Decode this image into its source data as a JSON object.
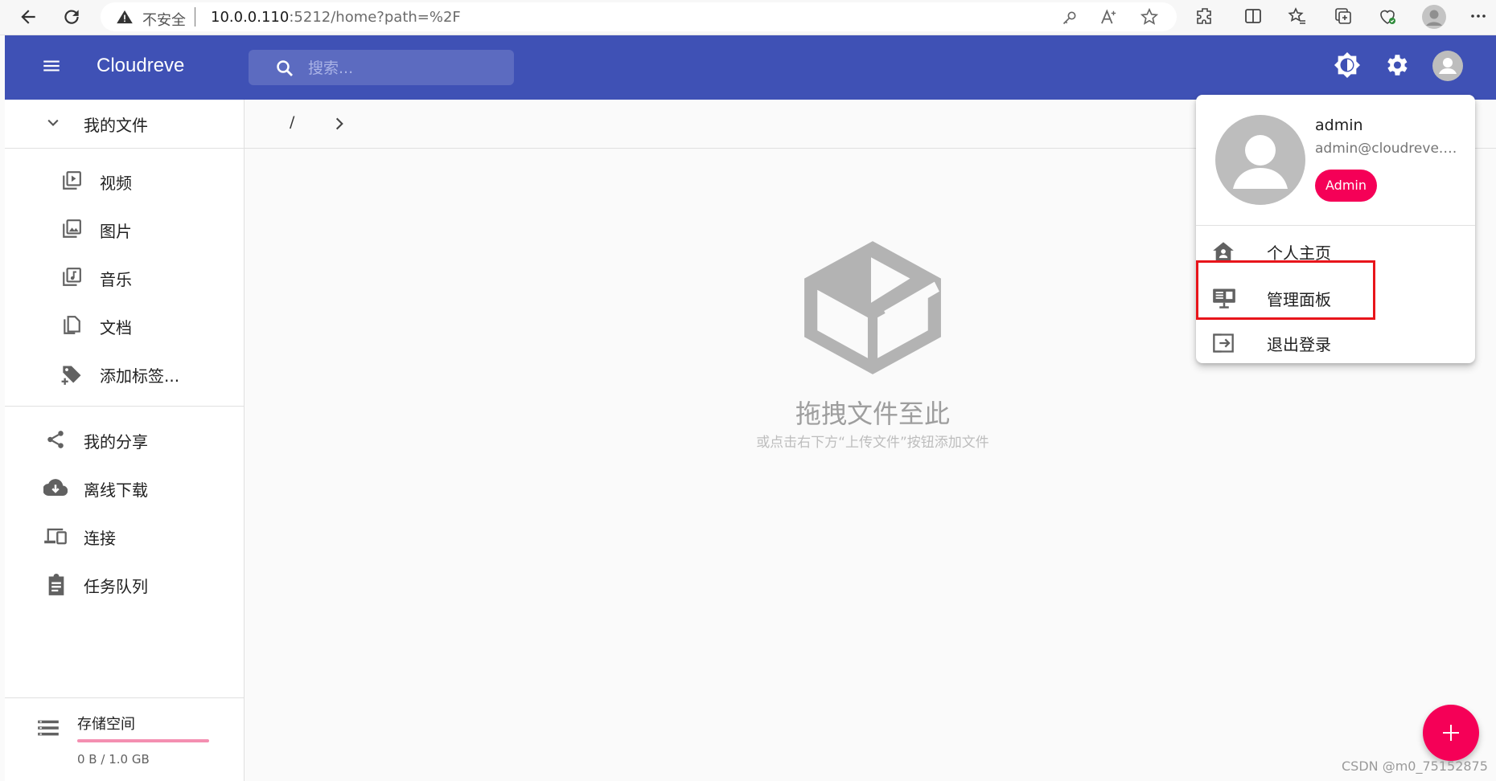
{
  "browser": {
    "security_label": "不安全",
    "url_host": "10.0.0.110",
    "url_path": ":5212/home?path=%2F"
  },
  "appbar": {
    "title": "Cloudreve",
    "search_placeholder": "搜索..."
  },
  "sidebar": {
    "my_files": "我的文件",
    "categories": [
      "视频",
      "图片",
      "音乐",
      "文档",
      "添加标签..."
    ],
    "share": "我的分享",
    "offline_download": "离线下载",
    "connect": "连接",
    "task_queue": "任务队列",
    "storage": {
      "title": "存储空间",
      "usage": "0 B / 1.0 GB",
      "used_fraction": 0
    }
  },
  "main": {
    "breadcrumb_root": "/",
    "empty_title": "拖拽文件至此",
    "empty_subtitle": "或点击右下方“上传文件”按钮添加文件"
  },
  "user_menu": {
    "name": "admin",
    "email": "admin@cloudreve.org",
    "role": "Admin",
    "items": [
      "个人主页",
      "管理面板",
      "退出登录"
    ]
  },
  "colors": {
    "primary": "#3f51b5",
    "accent": "#f50057",
    "highlight": "#e8151b"
  },
  "watermark": "CSDN @m0_75152875"
}
